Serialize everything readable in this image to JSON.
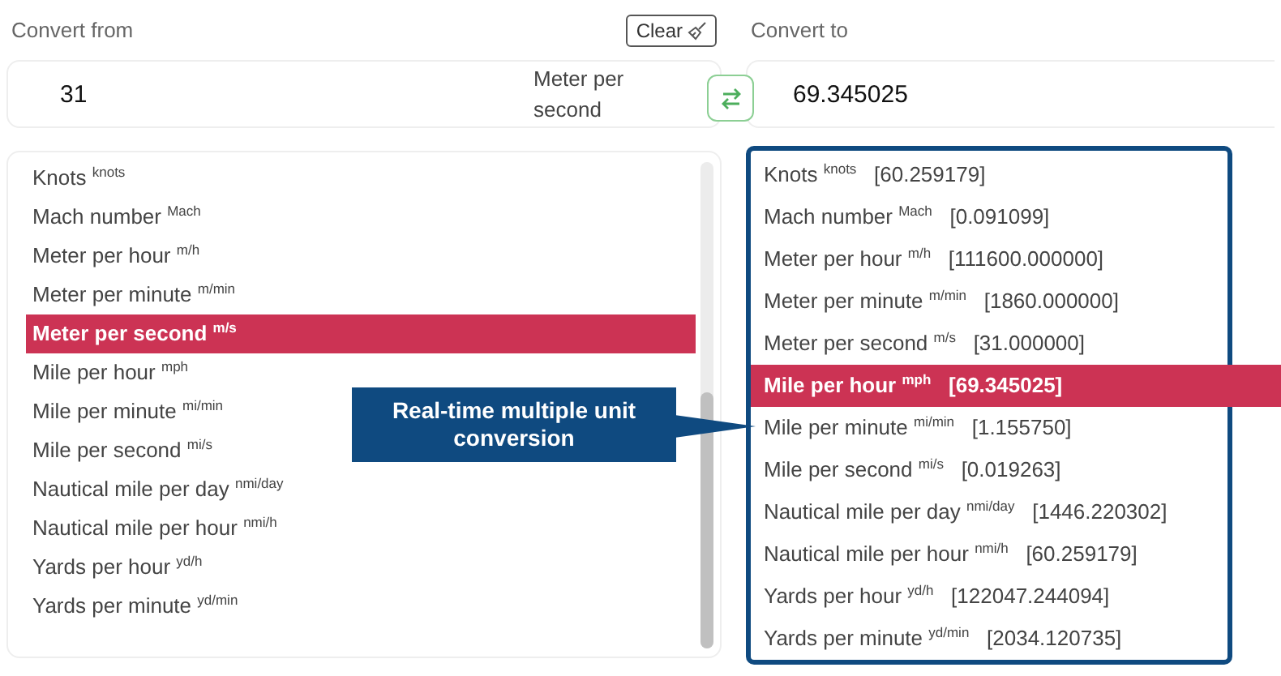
{
  "from": {
    "label": "Convert from",
    "clear_button": "Clear",
    "value": "31",
    "unit": "Meter per second"
  },
  "to": {
    "label": "Convert to",
    "value": "69.345025"
  },
  "from_units": [
    {
      "name": "Knots",
      "unit": "knots",
      "selected": false
    },
    {
      "name": "Mach number",
      "unit": "Mach",
      "selected": false
    },
    {
      "name": "Meter per hour",
      "unit": "m/h",
      "selected": false
    },
    {
      "name": "Meter per minute",
      "unit": "m/min",
      "selected": false
    },
    {
      "name": "Meter per second",
      "unit": "m/s",
      "selected": true
    },
    {
      "name": "Mile per hour",
      "unit": "mph",
      "selected": false
    },
    {
      "name": "Mile per minute",
      "unit": "mi/min",
      "selected": false
    },
    {
      "name": "Mile per second",
      "unit": "mi/s",
      "selected": false
    },
    {
      "name": "Nautical mile per day",
      "unit": "nmi/day",
      "selected": false
    },
    {
      "name": "Nautical mile per hour",
      "unit": "nmi/h",
      "selected": false
    },
    {
      "name": "Yards per hour",
      "unit": "yd/h",
      "selected": false
    },
    {
      "name": "Yards per minute",
      "unit": "yd/min",
      "selected": false
    }
  ],
  "to_units": [
    {
      "name": "Knots",
      "unit": "knots",
      "value": "[60.259179]",
      "selected": false
    },
    {
      "name": "Mach number",
      "unit": "Mach",
      "value": "[0.091099]",
      "selected": false
    },
    {
      "name": "Meter per hour",
      "unit": "m/h",
      "value": "[111600.000000]",
      "selected": false
    },
    {
      "name": "Meter per minute",
      "unit": "m/min",
      "value": "[1860.000000]",
      "selected": false
    },
    {
      "name": "Meter per second",
      "unit": "m/s",
      "value": "[31.000000]",
      "selected": false
    },
    {
      "name": "Mile per hour",
      "unit": "mph",
      "value": "[69.345025]",
      "selected": true
    },
    {
      "name": "Mile per minute",
      "unit": "mi/min",
      "value": "[1.155750]",
      "selected": false
    },
    {
      "name": "Mile per second",
      "unit": "mi/s",
      "value": "[0.019263]",
      "selected": false
    },
    {
      "name": "Nautical mile per day",
      "unit": "nmi/day",
      "value": "[1446.220302]",
      "selected": false
    },
    {
      "name": "Nautical mile per hour",
      "unit": "nmi/h",
      "value": "[60.259179]",
      "selected": false
    },
    {
      "name": "Yards per hour",
      "unit": "yd/h",
      "value": "[122047.244094]",
      "selected": false
    },
    {
      "name": "Yards per minute",
      "unit": "yd/min",
      "value": "[2034.120735]",
      "selected": false
    }
  ],
  "callout": "Real-time multiple unit conversion"
}
